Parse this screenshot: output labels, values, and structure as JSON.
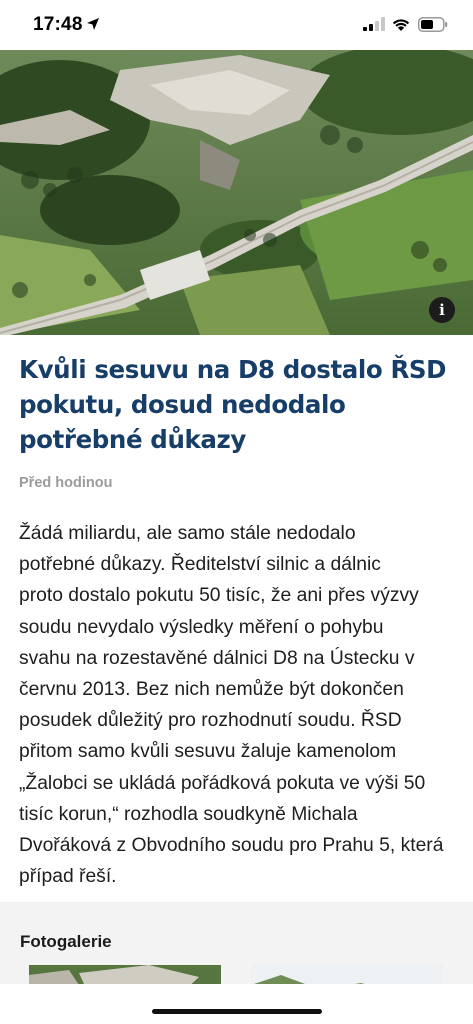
{
  "status_bar": {
    "time": "17:48"
  },
  "hero": {
    "description_icon": "info-icon",
    "info_glyph": "i"
  },
  "article": {
    "title_lines": [
      "Kvůli sesuvu na D8 dostalo ŘSD",
      "pokutu, dosud nedodalo",
      "potřebné důkazy"
    ],
    "published": "Před hodinou",
    "body_lines": [
      "Žádá miliardu, ale samo stále nedodalo",
      "potřebné důkazy. Ředitelství silnic a dálnic",
      "proto dostalo pokutu 50 tisíc, že ani přes výzvy",
      "soudu nevydalo výsledky měření o pohybu",
      "svahu na rozestavěné dálnici D8 na Ústecku v",
      "červnu 2013. Bez nich nemůže být dokončen",
      "posudek důležitý pro rozhodnutí soudu. ŘSD",
      "přitom samo kvůli sesuvu žaluje kamenolom",
      "„Žalobci se ukládá pořádková pokuta ve výši 50",
      "tisíc korun,“ rozhodla soudkyně Michala",
      "Dvořáková z Obvodního soudu pro Prahu 5, která",
      "případ řeší."
    ]
  },
  "gallery": {
    "heading": "Fotogalerie"
  },
  "colors": {
    "title": "#173e68",
    "timestamp": "#9b9b9b",
    "gallery_bg": "#f3f3f4"
  }
}
